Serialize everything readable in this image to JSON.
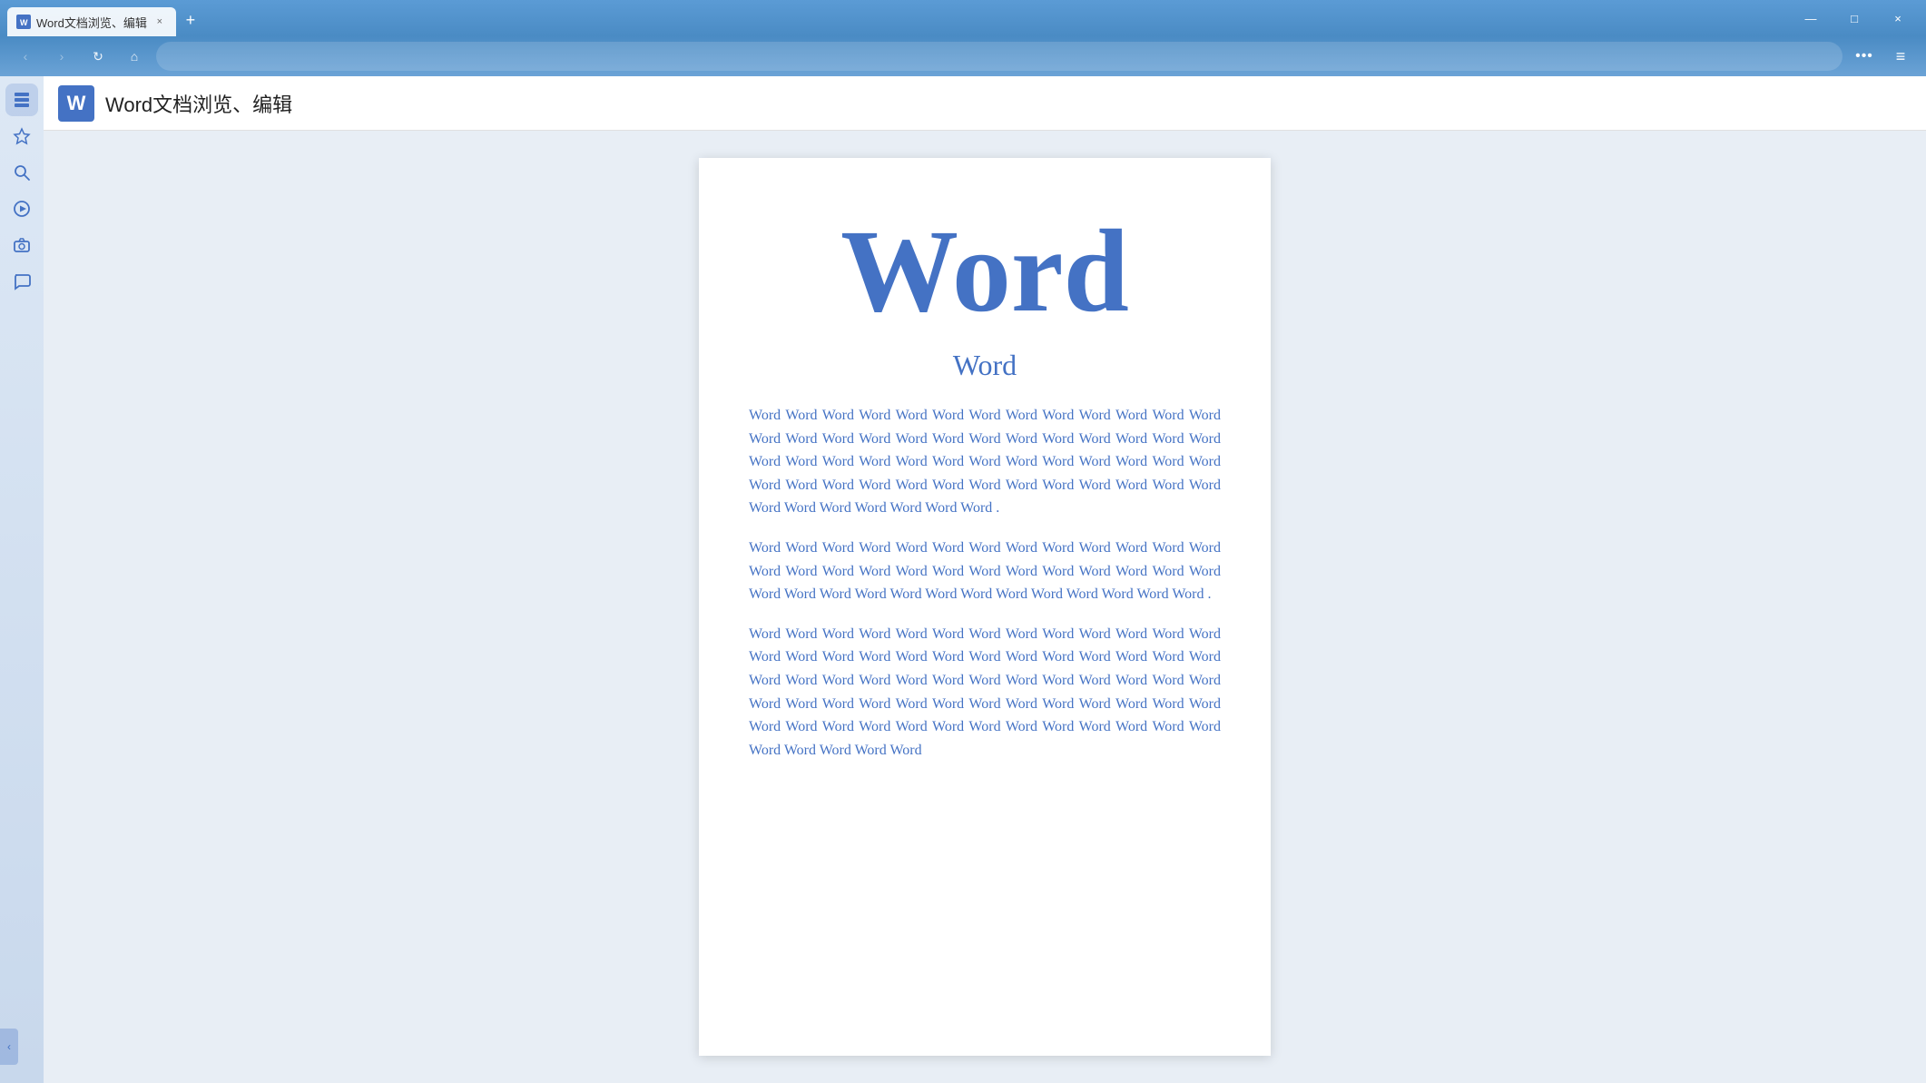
{
  "titleBar": {
    "tabTitle": "Word文档浏览、编辑",
    "closeLabel": "×",
    "minimizeLabel": "—",
    "maximizeLabel": "□",
    "newTabLabel": "+"
  },
  "navBar": {
    "backLabel": "‹",
    "forwardLabel": "›",
    "refreshLabel": "↻",
    "homeLabel": "⌂",
    "moreLabel": "•••",
    "menuLabel": "≡"
  },
  "sidebar": {
    "items": [
      {
        "name": "tabs",
        "icon": "⊟"
      },
      {
        "name": "favorites",
        "icon": "☆"
      },
      {
        "name": "search",
        "icon": "🔍"
      },
      {
        "name": "play",
        "icon": "▶"
      },
      {
        "name": "camera",
        "icon": "📷"
      },
      {
        "name": "chat",
        "icon": "💬"
      }
    ],
    "toggleLabel": "‹"
  },
  "pageTitle": {
    "favicon": "W",
    "title": "Word文档浏览、编辑"
  },
  "document": {
    "titleLarge": "Word",
    "subtitle": "Word",
    "paragraph1": "Word Word Word Word Word Word Word Word Word Word Word Word Word Word Word Word Word Word Word Word Word Word Word Word Word Word Word Word Word Word Word Word Word Word Word Word Word Word Word Word Word Word Word Word Word Word Word Word Word Word Word Word Word Word Word Word Word Word Word .",
    "paragraph2": "Word Word Word Word Word Word Word Word Word Word Word Word Word Word Word Word Word Word Word Word Word Word Word Word Word Word Word Word Word Word Word Word Word Word Word Word Word Word Word .",
    "paragraph3": "Word Word Word Word Word Word Word Word Word Word Word Word Word Word Word Word Word Word Word Word Word Word Word Word Word Word Word Word Word Word Word Word Word Word Word Word Word Word Word Word Word Word Word Word Word Word Word Word Word Word Word Word Word Word Word Word Word Word Word Word Word Word Word Word Word Word Word Word Word Word"
  }
}
